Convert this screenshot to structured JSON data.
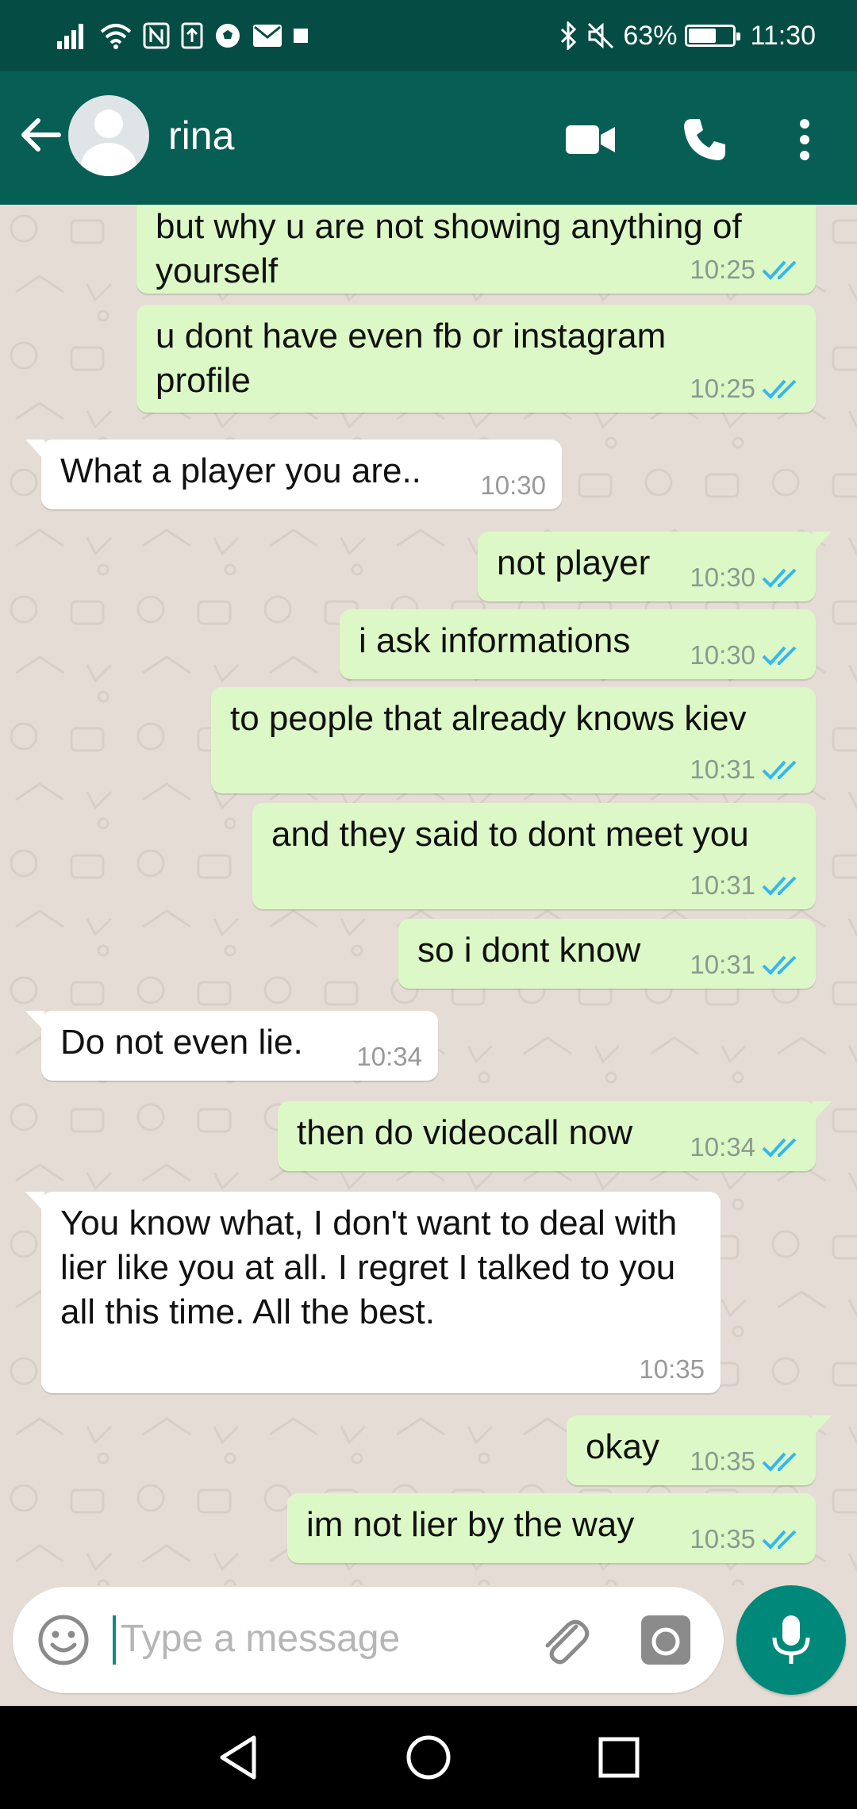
{
  "status_bar": {
    "battery": "63%",
    "battery_level": 0.63,
    "time": "11:30"
  },
  "toolbar": {
    "contact_name": "rina",
    "icons": [
      "back-arrow-icon",
      "avatar",
      "video-call-icon",
      "phone-icon",
      "more-vert-icon"
    ]
  },
  "colors": {
    "header": "#075e54",
    "status_bar": "#054d44",
    "outgoing_bubble": "#dcf8c6",
    "incoming_bubble": "#ffffff",
    "tick_read": "#34b7f1",
    "accent": "#00897b"
  },
  "messages": [
    {
      "dir": "out",
      "text": "but why u are not showing anything of yourself",
      "time": "10:25",
      "status": "read"
    },
    {
      "dir": "out",
      "text": "u dont have even fb or instagram profile",
      "time": "10:25",
      "status": "read"
    },
    {
      "dir": "in",
      "text": "What a player you are..",
      "time": "10:30"
    },
    {
      "dir": "out",
      "text": "not player",
      "time": "10:30",
      "status": "read"
    },
    {
      "dir": "out",
      "text": "i ask informations",
      "time": "10:30",
      "status": "read"
    },
    {
      "dir": "out",
      "text": "to people that already knows kiev",
      "time": "10:31",
      "status": "read"
    },
    {
      "dir": "out",
      "text": "and they said to dont meet you",
      "time": "10:31",
      "status": "read"
    },
    {
      "dir": "out",
      "text": "so i dont know",
      "time": "10:31",
      "status": "read"
    },
    {
      "dir": "in",
      "text": "Do not even lie.",
      "time": "10:34"
    },
    {
      "dir": "out",
      "text": "then do videocall now",
      "time": "10:34",
      "status": "read"
    },
    {
      "dir": "in",
      "text": "You know what, I don't want to deal with lier like you at all.  I regret I talked to you all this time.  All the best.",
      "time": "10:35"
    },
    {
      "dir": "out",
      "text": "okay",
      "time": "10:35",
      "status": "read"
    },
    {
      "dir": "out",
      "text": "im not lier by the way",
      "time": "10:35",
      "status": "read"
    }
  ],
  "input": {
    "placeholder": "Type a message"
  }
}
